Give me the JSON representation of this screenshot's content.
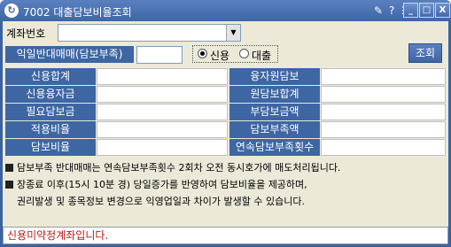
{
  "window": {
    "title": "7002 대출담보비율조회",
    "icons": {
      "app": "app-logo-icon",
      "pin": "pin-icon",
      "help": "help-icon",
      "menu": "menu-icon"
    },
    "buttons": {
      "minimize": "_",
      "maximize": "□",
      "close": "X"
    }
  },
  "form": {
    "account_label": "계좌번호",
    "account_value": "",
    "combo_arrow": "▼",
    "qty_label": "익일반대매매(담보부족)",
    "qty_value": "",
    "radio_options": [
      {
        "label": "신용",
        "selected": true
      },
      {
        "label": "대출",
        "selected": false
      }
    ],
    "query_button": "조회"
  },
  "grid": {
    "rows": [
      {
        "left_label": "신용합계",
        "left_value": "",
        "right_label": "융자원담보",
        "right_value": ""
      },
      {
        "left_label": "신용융자금",
        "left_value": "",
        "right_label": "원담보합계",
        "right_value": ""
      },
      {
        "left_label": "필요담보금",
        "left_value": "",
        "right_label": "부담보금액",
        "right_value": ""
      },
      {
        "left_label": "적용비율",
        "left_value": "",
        "right_label": "담보부족액",
        "right_value": ""
      },
      {
        "left_label": "담보비율",
        "left_value": "",
        "right_label": "연속담보부족횟수",
        "right_value": ""
      }
    ]
  },
  "notes": [
    "담보부족 반대매매는 연속담보부족횟수 2회차 오전 동시호가에 매도처리됩니다.",
    "장종료 이후(15시 10분 경) 당일증가를 반영하여 담보비율을 제공하며,",
    "권리발생 및 종목정보 변경으로 익영업일과 차이가 발생할 수 있습니다."
  ],
  "status": {
    "message": "신용미약정계좌입니다.",
    "color": "#b81818"
  },
  "colors": {
    "title_bar": "#3e66a6",
    "label_bg": "#3d66a2",
    "panel_bg": "#ece9d8"
  }
}
